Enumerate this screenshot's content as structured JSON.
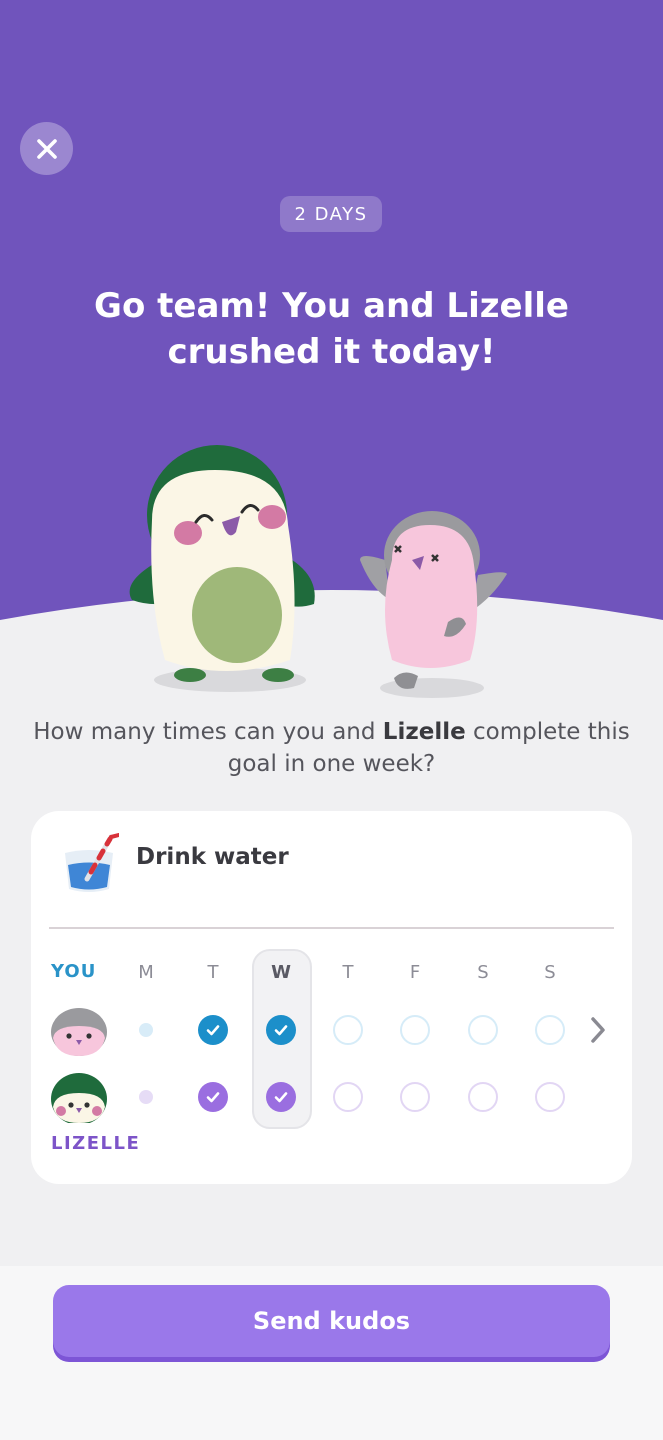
{
  "colors": {
    "hero_purple": "#7054bc",
    "you_blue": "#1c8fca",
    "partner_purple": "#9a6ee0",
    "button": "#9a78ea"
  },
  "close_icon": "close-icon",
  "streak_badge": "2 DAYS",
  "headline": "Go team! You and Lizelle crushed it today!",
  "question": {
    "before": "How many times can you and ",
    "name": "Lizelle",
    "after": " complete this goal in one week?"
  },
  "goal": {
    "icon": "water-glass-icon",
    "title": "Drink water"
  },
  "tracker": {
    "you_label": "YOU",
    "partner_label": "LIZELLE",
    "days": [
      "M",
      "T",
      "W",
      "T",
      "F",
      "S",
      "S"
    ],
    "today_index": 2,
    "you_status": [
      "none",
      "done",
      "done",
      "empty",
      "empty",
      "empty",
      "empty"
    ],
    "partner_status": [
      "none",
      "done",
      "done",
      "empty",
      "empty",
      "empty",
      "empty"
    ]
  },
  "send_button": "Send kudos"
}
